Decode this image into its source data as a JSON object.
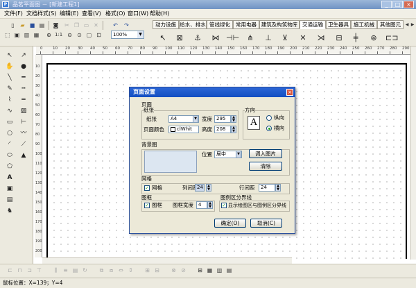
{
  "app": {
    "title": "品茗平面图 － [新建工程1]",
    "window_buttons": [
      "_",
      "□",
      "×"
    ]
  },
  "menubar": {
    "items": [
      "文件(F)",
      "文档样式(S)",
      "编辑(E)",
      "查看(V)",
      "格式(O)",
      "窗口(W)",
      "帮助(H)"
    ]
  },
  "toolbar": {
    "zoom_value": "100%",
    "ratio_label": "1:1"
  },
  "library_tabs": [
    "动力设施",
    "给水、排水",
    "管线绿化",
    "常用电器",
    "建筑及构筑物库",
    "交通运输",
    "卫生器具",
    "施工机械",
    "其他图元"
  ],
  "active_library_tab": "交通运输",
  "ruler": {
    "h_labels": [
      "0",
      "10",
      "20",
      "30",
      "40",
      "50",
      "60",
      "70",
      "80",
      "90",
      "100",
      "110",
      "120",
      "130",
      "140",
      "150",
      "160",
      "170",
      "180",
      "190",
      "200",
      "210",
      "220",
      "230",
      "240",
      "250",
      "260",
      "270",
      "280",
      "290"
    ],
    "v_labels": [
      "10",
      "20",
      "30",
      "40",
      "50",
      "60",
      "70",
      "80",
      "90",
      "100",
      "110",
      "120",
      "130",
      "140",
      "150",
      "160",
      "170",
      "180",
      "190",
      "200"
    ]
  },
  "dialog": {
    "title": "页面设置",
    "page_section": "页面",
    "paper_group": "纸张",
    "paper_label": "纸张",
    "paper_value": "A4",
    "width_label": "宽度",
    "width_value": "295",
    "page_color_label": "页面颜色",
    "page_color_value": "clWhit",
    "height_label": "高度",
    "height_value": "208",
    "orientation_group": "方向",
    "orientation_portrait": "纵向",
    "orientation_landscape": "横向",
    "orientation_selected": "横向",
    "orientation_glyph": "A",
    "background_group": "背景图",
    "position_label": "位置",
    "position_value": "居中",
    "import_button": "调入图片",
    "clear_button": "清除",
    "grid_group": "网格",
    "grid_check_label": "网格",
    "grid_checked": true,
    "col_spacing_label": "列间距",
    "col_spacing_value": "24",
    "row_spacing_label": "行间距",
    "row_spacing_value": "24",
    "frame_group": "图框",
    "frame_check_label": "图框",
    "frame_checked": true,
    "frame_width_label": "图框宽度",
    "frame_width_value": "4",
    "legend_group": "图例区分界线",
    "legend_check_label": "显示绘图区与图例区分界线",
    "legend_checked": true,
    "ok_button": "确定(O)",
    "cancel_button": "取消(C)"
  },
  "status": {
    "mouse_position": "鼠标位置：X=139；Y=4"
  }
}
